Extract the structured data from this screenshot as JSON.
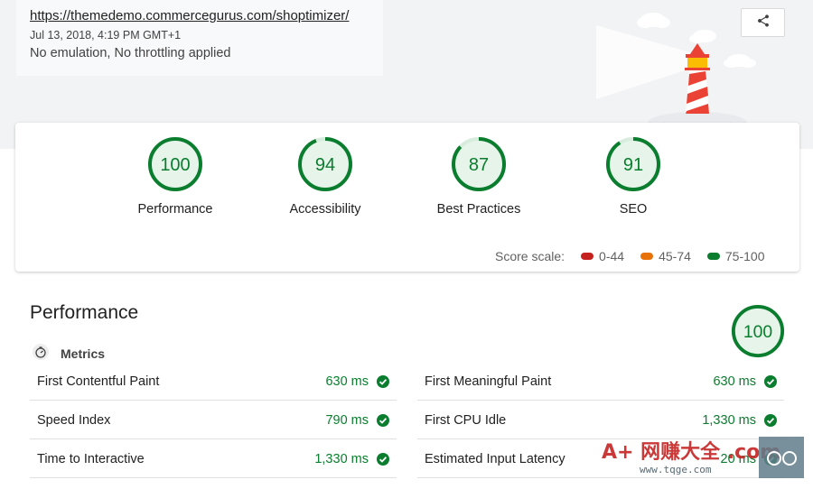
{
  "header": {
    "url": "https://themedemo.commercegurus.com/shoptimizer/",
    "date": "Jul 13, 2018, 4:19 PM GMT+1",
    "settings": "No emulation, No throttling applied",
    "share_icon": "share-icon"
  },
  "scores": [
    {
      "label": "Performance",
      "value": "100",
      "score": 100
    },
    {
      "label": "Accessibility",
      "value": "94",
      "score": 94
    },
    {
      "label": "Best Practices",
      "value": "87",
      "score": 87
    },
    {
      "label": "SEO",
      "value": "91",
      "score": 91
    }
  ],
  "legend": {
    "title": "Score scale:",
    "ranges": [
      {
        "label": "0-44",
        "color": "#c5221f"
      },
      {
        "label": "45-74",
        "color": "#e8710a"
      },
      {
        "label": "75-100",
        "color": "#0a7d2e"
      }
    ]
  },
  "performance": {
    "title": "Performance",
    "score": "100",
    "metrics_title": "Metrics",
    "metrics": [
      {
        "name": "First Contentful Paint",
        "value": "630 ms"
      },
      {
        "name": "First Meaningful Paint",
        "value": "630 ms"
      },
      {
        "name": "Speed Index",
        "value": "790 ms"
      },
      {
        "name": "First CPU Idle",
        "value": "1,330 ms"
      },
      {
        "name": "Time to Interactive",
        "value": "1,330 ms"
      },
      {
        "name": "Estimated Input Latency",
        "value": "20 ms"
      }
    ]
  },
  "colors": {
    "pass": "#0a7d2e",
    "pass_track": "#e6f4ea"
  },
  "watermark": {
    "text": "A+ 网赚大全 .com",
    "sub": "www.tqge.com"
  }
}
